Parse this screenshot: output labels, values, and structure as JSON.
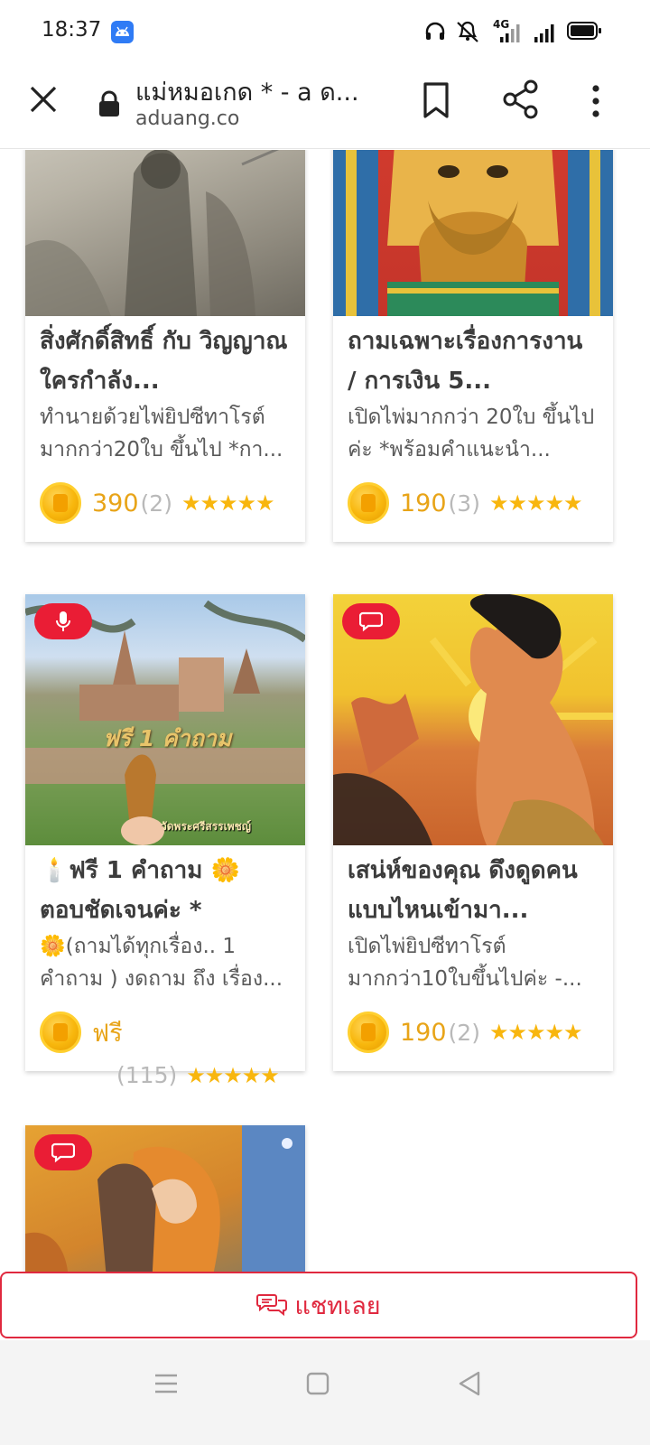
{
  "status_bar": {
    "time": "18:37",
    "network_label": "4G"
  },
  "browser": {
    "title": "แม่หมอเกด *  - a ด...",
    "domain": "aduang.co"
  },
  "cards": [
    {
      "title": "สิ่งศักดิ์สิทธิ์ กับ วิญญาณ ใครกำลัง...",
      "desc": "ทำนายด้วยไพ่ยิปซีทาโรต์มากกว่า20ใบ ขึ้นไป *กา...",
      "price": "390",
      "count": "(2)",
      "stars": "★★★★★"
    },
    {
      "title": "ถามเฉพาะเรื่องการงาน / การเงิน 5...",
      "desc": "เปิดไพ่มากกว่า 20ใบ ขึ้นไปค่ะ *พร้อมคำแนะนำ...",
      "price": "190",
      "count": "(3)",
      "stars": "★★★★★"
    },
    {
      "title": "🕯️ฟรี 1 คำถาม 🌼 ตอบชัดเจนค่ะ *",
      "desc": "🌼(ถามได้ทุกเรื่อง.. 1 คำถาม ) งดถาม ถึง เรื่อง...",
      "price": "ฟรี",
      "count": "(115)",
      "stars": "★★★★★",
      "image_text": "ฟรี 1 คำถาม",
      "image_caption": "วัดพระศรีสรรเพชญ์"
    },
    {
      "title": "เสน่ห์ของคุณ ดึงดูดคนแบบไหนเข้ามา...",
      "desc": "เปิดไพ่ยิปซีทาโรต์มากกว่า10ใบขึ้นไปค่ะ -...",
      "price": "190",
      "count": "(2)",
      "stars": "★★★★★"
    }
  ],
  "chat_button": {
    "label": "แชทเลย"
  },
  "icons": {
    "close": "close-icon",
    "lock": "lock-icon",
    "bookmark": "bookmark-icon",
    "share": "share-icon",
    "menu": "more-vert-icon",
    "mic": "mic-icon",
    "chat": "chat-bubble-icon",
    "coin": "coin-icon",
    "nav_menu": "menu-lines-icon",
    "nav_home": "square-icon",
    "nav_back": "triangle-back-icon"
  },
  "colors": {
    "accent_red": "#ea1d35",
    "price_gold": "#e8a418",
    "star_gold": "#f8b60e"
  }
}
